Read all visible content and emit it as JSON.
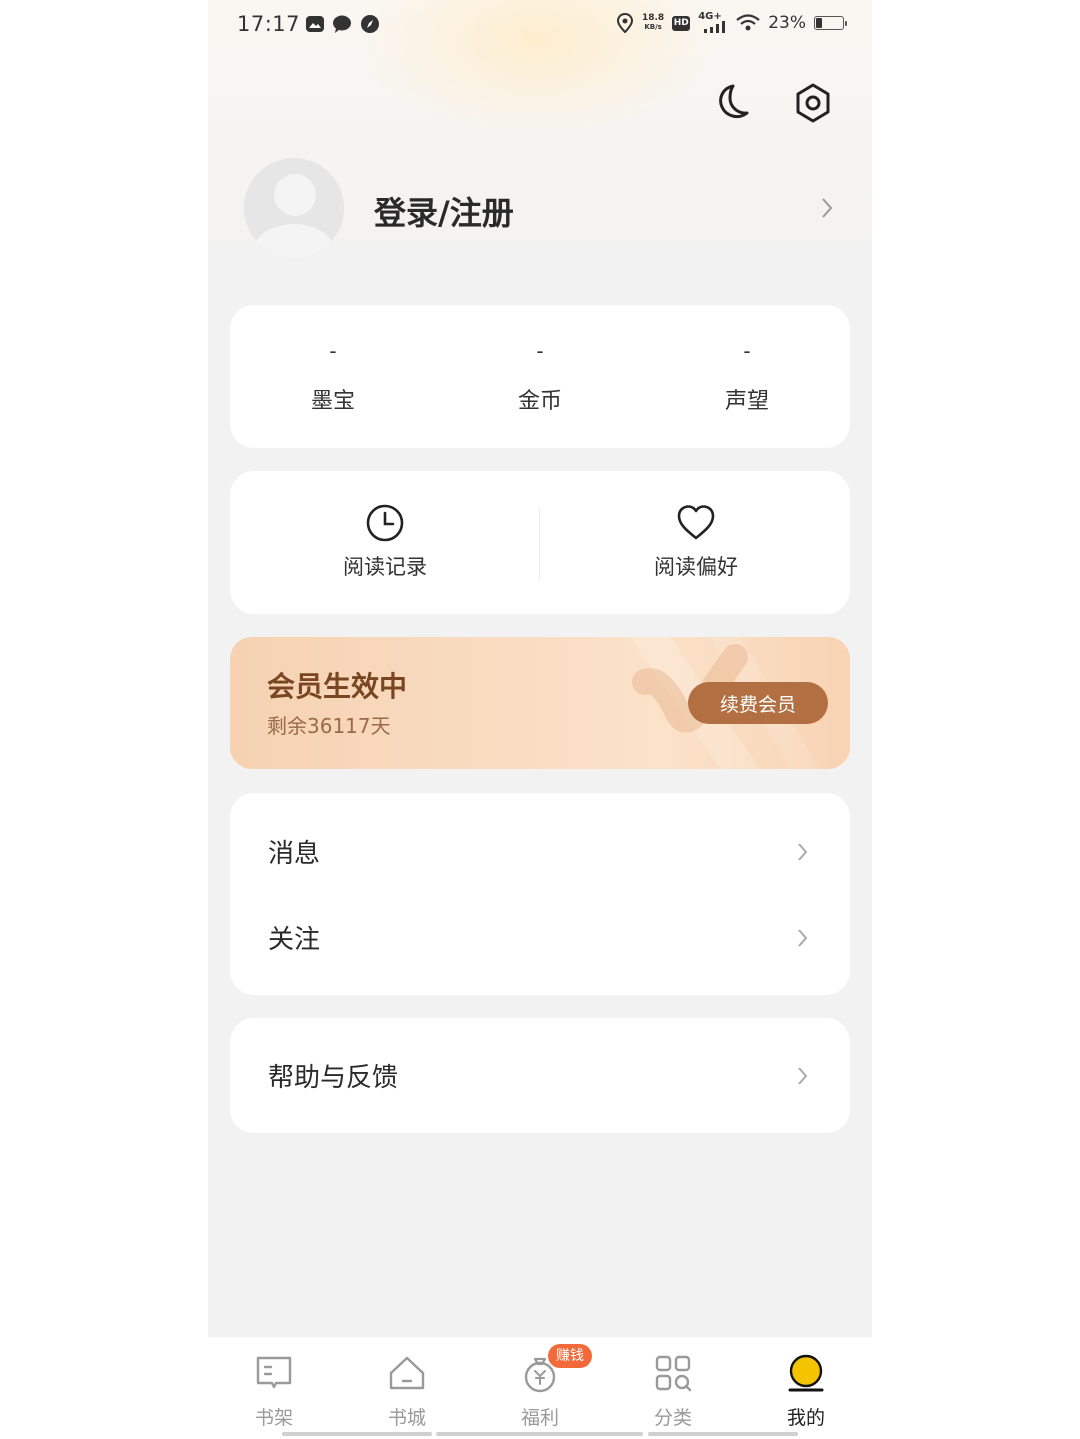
{
  "status_bar": {
    "time": "17:17",
    "speed_top": "18.8",
    "speed_bottom": "KB/s",
    "hd": "HD",
    "network": "4G+",
    "battery": "23%",
    "battery_level": 0.23
  },
  "header": {
    "icons": [
      "moon-icon",
      "settings-icon"
    ]
  },
  "profile": {
    "login_label": "登录/注册"
  },
  "stats": [
    {
      "value": "-",
      "label": "墨宝"
    },
    {
      "value": "-",
      "label": "金币"
    },
    {
      "value": "-",
      "label": "声望"
    }
  ],
  "quick_actions": [
    {
      "label": "阅读记录",
      "icon": "clock-icon"
    },
    {
      "label": "阅读偏好",
      "icon": "heart-icon"
    }
  ],
  "vip": {
    "title": "会员生效中",
    "subtitle": "剩余36117天",
    "button": "续费会员"
  },
  "menu_group_1": [
    {
      "label": "消息"
    },
    {
      "label": "关注"
    }
  ],
  "menu_group_2": [
    {
      "label": "帮助与反馈"
    }
  ],
  "tabbar": {
    "tabs": [
      {
        "label": "书架",
        "icon": "bookshelf-icon"
      },
      {
        "label": "书城",
        "icon": "home-icon"
      },
      {
        "label": "福利",
        "icon": "money-bag-icon"
      },
      {
        "label": "分类",
        "icon": "category-icon"
      },
      {
        "label": "我的",
        "icon": "profile-icon"
      }
    ],
    "badge": "赚钱",
    "active": "我的",
    "accent_color": "#f5c400"
  },
  "colors": {
    "vip_button": "#b16f42",
    "badge": "#f36a3a"
  }
}
